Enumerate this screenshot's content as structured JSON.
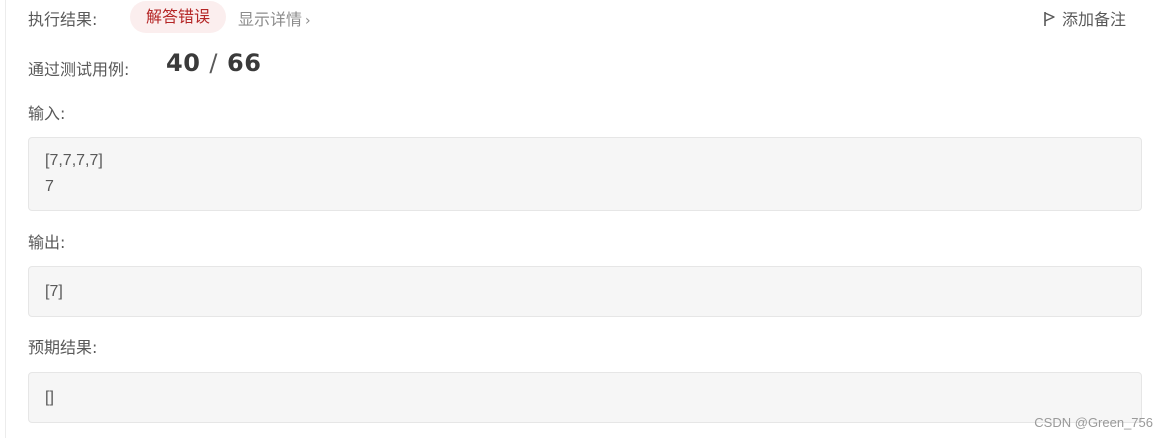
{
  "header": {
    "result_label": "执行结果:",
    "result_status": "解答错误",
    "details_label": "显示详情",
    "details_chevron": "›",
    "add_note_label": "添加备注",
    "add_note_icon": "flag-icon"
  },
  "tests": {
    "label": "通过测试用例:",
    "passed": "40",
    "separator": "/",
    "total": "66"
  },
  "input": {
    "label": "输入:",
    "lines": [
      "[7,7,7,7]",
      "7"
    ]
  },
  "output": {
    "label": "输出:",
    "value": "[7]"
  },
  "expected": {
    "label": "预期结果:",
    "value": "[]"
  },
  "watermark": "CSDN @Green_756",
  "colors": {
    "error_text": "#b42525",
    "error_bg": "#fbeeee",
    "box_bg": "#f6f6f6"
  }
}
